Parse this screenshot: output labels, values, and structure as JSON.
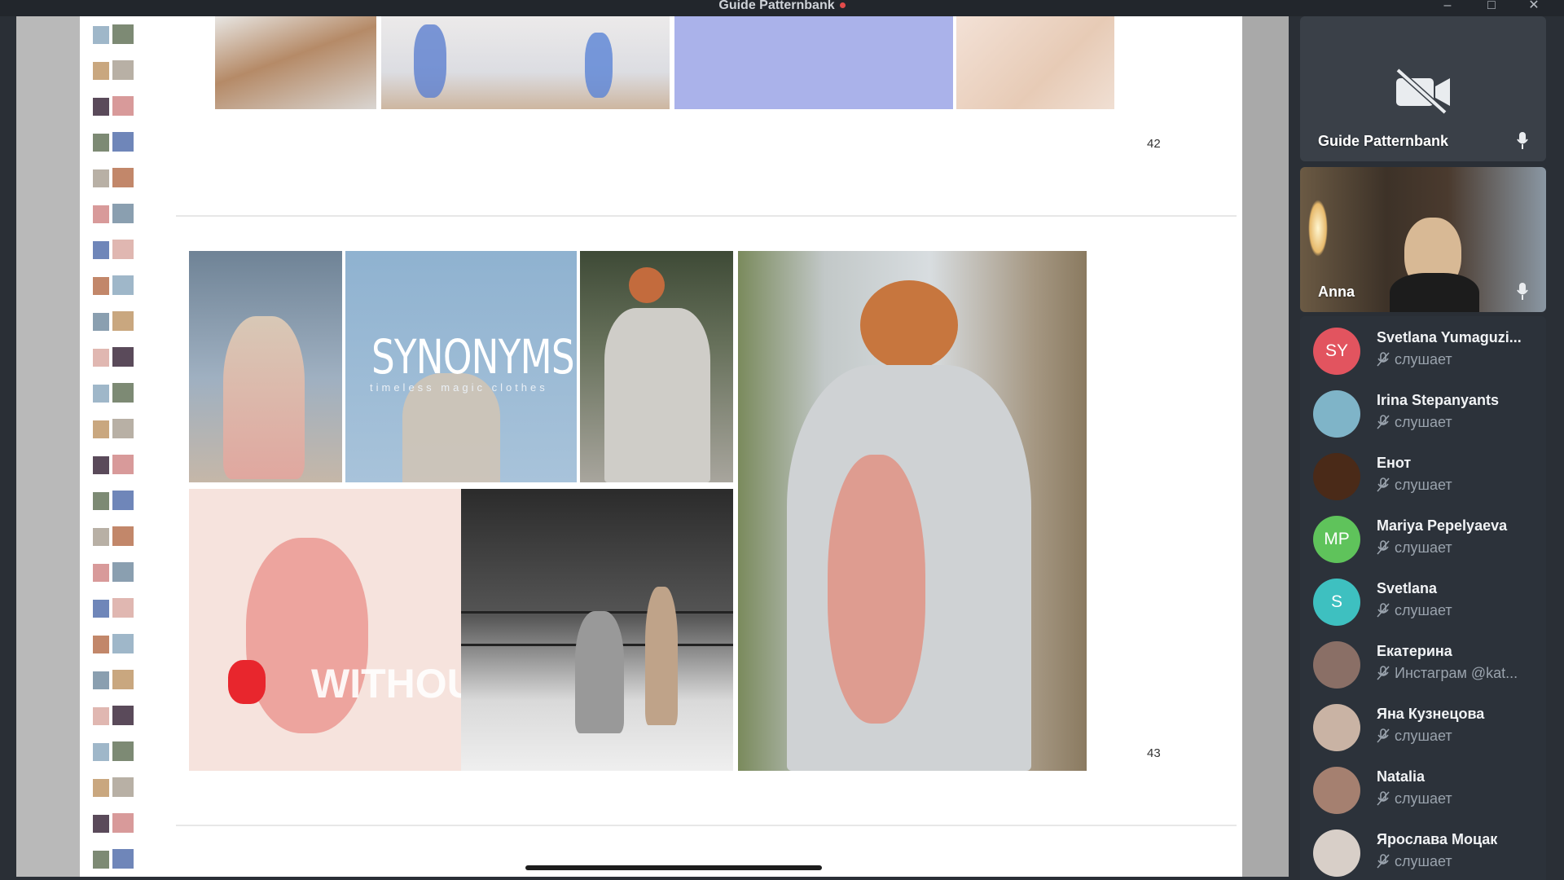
{
  "window": {
    "title": "Guide Patternbank",
    "recording_dot_color": "#e24b4b"
  },
  "document": {
    "page_numbers": [
      "42",
      "43"
    ],
    "slide_text": {
      "brand": "SYNONYMS",
      "tagline": "timeless magic clothes",
      "overlay": "WITHOUT"
    }
  },
  "video_tiles": [
    {
      "name": "Guide Patternbank",
      "camera": "off",
      "icon": "camera-off-icon"
    },
    {
      "name": "Anna",
      "camera": "on"
    }
  ],
  "participants": [
    {
      "initials": "SY",
      "avatar_color": "#e2545f",
      "name": "Svetlana Yumaguzi...",
      "status": "слушает"
    },
    {
      "initials": "",
      "avatar_color": "#7fb4c8",
      "name": "Irina Stepanyants",
      "status": "слушает"
    },
    {
      "initials": "",
      "avatar_color": "#4a2a18",
      "name": "Енот",
      "status": "слушает"
    },
    {
      "initials": "MP",
      "avatar_color": "#5fc35b",
      "name": "Mariya Pepelyaeva",
      "status": "слушает"
    },
    {
      "initials": "S",
      "avatar_color": "#3ec0c0",
      "name": "Svetlana",
      "status": "слушает"
    },
    {
      "initials": "",
      "avatar_color": "#8a6f66",
      "name": "Екатерина",
      "status": "Инстаграм @kat..."
    },
    {
      "initials": "",
      "avatar_color": "#c9b3a4",
      "name": "Яна Кузнецова",
      "status": "слушает"
    },
    {
      "initials": "",
      "avatar_color": "#a58070",
      "name": "Natalia",
      "status": "слушает"
    },
    {
      "initials": "",
      "avatar_color": "#d8cfc8",
      "name": "Ярослава Моцак",
      "status": "слушает"
    }
  ]
}
